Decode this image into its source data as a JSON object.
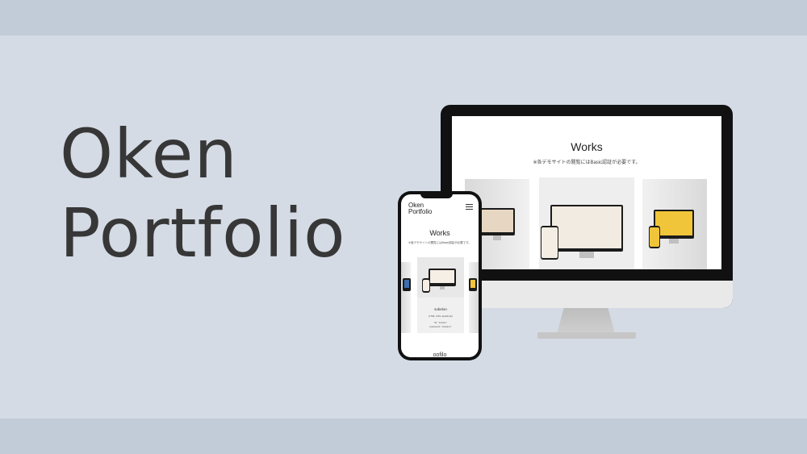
{
  "hero": {
    "line1": "Oken",
    "line2": "Portfolio"
  },
  "desktop": {
    "heading": "Works",
    "note": "※各デモサイトの閲覧にはBasic認証が必要です。"
  },
  "phone": {
    "logo_line1": "Oken",
    "logo_line2": "Portfolio",
    "heading": "Works",
    "note": "※各デモサイトの閲覧にはBasic認証が必要です。",
    "card_title": "sobelon",
    "card_tech": "HTML CSS JavaScript",
    "card_id": "ID: \"sobelo\"",
    "card_pass": "password: \"sobelon\"",
    "next_title": "oofilo"
  },
  "colors": {
    "background": "#d4dbe5",
    "band": "#c1ccd8",
    "title_text": "#373737",
    "device_frame": "#111111"
  },
  "icons": [
    "hamburger-menu-icon"
  ]
}
